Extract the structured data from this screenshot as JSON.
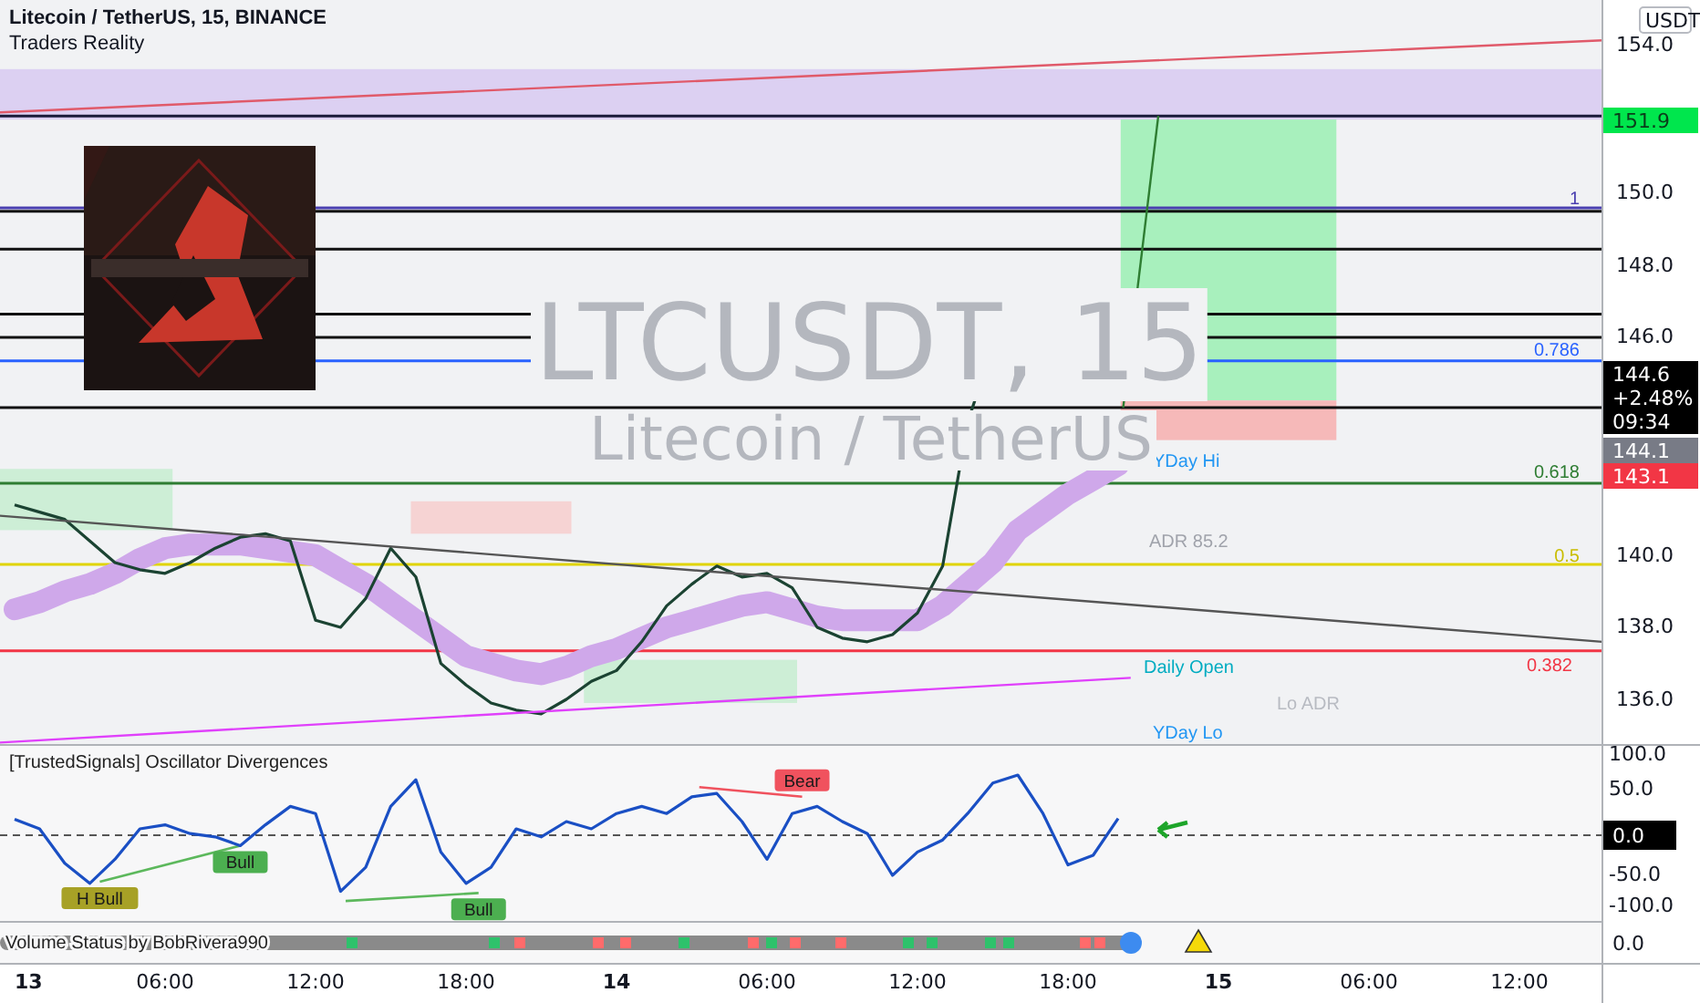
{
  "header": {
    "title": "Litecoin / TetherUS, 15, BINANCE",
    "indicator": "Traders Reality"
  },
  "watermark": {
    "symbol": "LTCUSDT, 15",
    "description": "Litecoin / TetherUS"
  },
  "logo": {
    "kind": "picture"
  },
  "price_axis": {
    "currency": "USDT",
    "ticks": [
      "154.0",
      "150.0",
      "148.0",
      "146.0",
      "140.0",
      "138.0",
      "136.0"
    ],
    "tags": [
      {
        "kind": "target",
        "lines": [
          "151.9"
        ]
      },
      {
        "kind": "last",
        "lines": [
          "144.6",
          "+2.48%",
          "09:34"
        ]
      },
      {
        "kind": "previous",
        "lines": [
          "144.1"
        ]
      },
      {
        "kind": "stop",
        "lines": [
          "143.1"
        ]
      }
    ]
  },
  "chart_labels": [
    "1",
    "0.786",
    "0.618",
    "0.5",
    "0.382",
    "YDay Hi",
    "ADR 85.2",
    "Daily Open",
    "Lo ADR",
    "YDay Lo"
  ],
  "oscillator": {
    "title": "[TrustedSignals] Oscillator Divergences",
    "ticks": [
      "100.0",
      "50.0",
      "-50.0",
      "-100.0"
    ],
    "value_tag": "0.0",
    "signals": [
      {
        "kind": "hidden_bull",
        "label": "H Bull"
      },
      {
        "kind": "bull",
        "label": "Bull"
      },
      {
        "kind": "bull",
        "label": "Bull"
      },
      {
        "kind": "bear",
        "label": "Bear"
      }
    ]
  },
  "volume_pane": {
    "title": "Volume Status by BobRivera990",
    "axis_label": "0.0"
  },
  "time_axis": [
    {
      "label": "13",
      "kind": "day"
    },
    {
      "label": "06:00",
      "kind": "time"
    },
    {
      "label": "12:00",
      "kind": "time"
    },
    {
      "label": "18:00",
      "kind": "time"
    },
    {
      "label": "14",
      "kind": "day"
    },
    {
      "label": "06:00",
      "kind": "time"
    },
    {
      "label": "12:00",
      "kind": "time"
    },
    {
      "label": "18:00",
      "kind": "time"
    },
    {
      "label": "15",
      "kind": "day"
    },
    {
      "label": "06:00",
      "kind": "time"
    },
    {
      "label": "12:00",
      "kind": "time"
    }
  ]
}
